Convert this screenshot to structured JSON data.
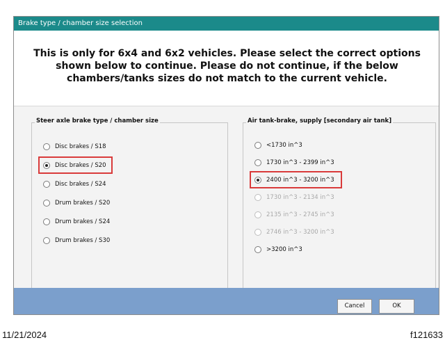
{
  "dialog": {
    "title": "Brake type / chamber size selection",
    "message": "This is only for 6x4 and 6x2 vehicles. Please select the correct options shown below to continue. Please do not continue, if the below chambers/tanks sizes do not match to the current vehicle."
  },
  "steer_group": {
    "legend": "Steer axle brake type / chamber size",
    "options": [
      {
        "label": "Disc brakes / S18",
        "checked": false,
        "enabled": true
      },
      {
        "label": "Disc brakes / S20",
        "checked": true,
        "enabled": true
      },
      {
        "label": "Disc brakes / S24",
        "checked": false,
        "enabled": true
      },
      {
        "label": "Drum brakes / S20",
        "checked": false,
        "enabled": true
      },
      {
        "label": "Drum brakes / S24",
        "checked": false,
        "enabled": true
      },
      {
        "label": "Drum brakes / S30",
        "checked": false,
        "enabled": true
      }
    ]
  },
  "tank_group": {
    "legend": "Air tank-brake, supply [secondary air tank]",
    "options": [
      {
        "label": "<1730 in^3",
        "checked": false,
        "enabled": true
      },
      {
        "label": "1730 in^3 - 2399 in^3",
        "checked": false,
        "enabled": true
      },
      {
        "label": "2400 in^3 - 3200 in^3",
        "checked": true,
        "enabled": true
      },
      {
        "label": "1730 in^3 - 2134 in^3",
        "checked": false,
        "enabled": false
      },
      {
        "label": "2135 in^3 - 2745 in^3",
        "checked": false,
        "enabled": false
      },
      {
        "label": "2746 in^3 - 3200 in^3",
        "checked": false,
        "enabled": false
      },
      {
        "label": ">3200 in^3",
        "checked": false,
        "enabled": true
      }
    ]
  },
  "buttons": {
    "cancel": "Cancel",
    "ok": "OK"
  },
  "footer_text": {
    "date": "11/21/2024",
    "figure_id": "f121633"
  },
  "colors": {
    "titlebar": "#1b8a8a",
    "footer_bar": "#7b9fcc",
    "highlight": "#d93a3a"
  }
}
